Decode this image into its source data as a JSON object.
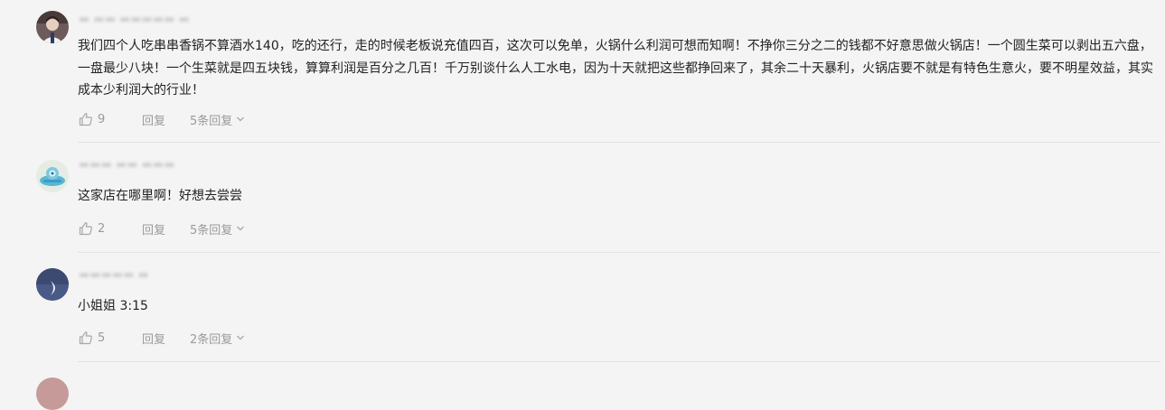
{
  "comments": [
    {
      "username": "▬ ▬▬ ▬▬▬▬▬ ▬",
      "text": "我们四个人吃串串香锅不算酒水140，吃的还行，走的时候老板说充值四百，这次可以免单，火锅什么利润可想而知啊！不挣你三分之二的钱都不好意思做火锅店！一个圆生菜可以剥出五六盘，一盘最少八块！一个生菜就是四五块钱，算算利润是百分之几百！千万别谈什么人工水电，因为十天就把这些都挣回来了，其余二十天暴利，火锅店要不就是有特色生意火，要不明星效益，其实成本少利润大的行业！",
      "likes": "9",
      "reply_label": "回复",
      "replies_label": "5条回复"
    },
    {
      "username": "▬▬▬ ▬▬ ▬▬▬",
      "text": "这家店在哪里啊！好想去尝尝",
      "likes": "2",
      "reply_label": "回复",
      "replies_label": "5条回复"
    },
    {
      "username": "▬▬▬▬▬ ▬",
      "text": "小姐姐 3:15",
      "likes": "5",
      "reply_label": "回复",
      "replies_label": "2条回复"
    }
  ],
  "watermark": "",
  "colors": {
    "background": "#f4f4f4",
    "text": "#222222",
    "meta": "#9a9a9a",
    "divider": "#e2e2e2"
  },
  "icons": {
    "like": "thumbs-up-icon",
    "expand": "chevron-down-icon"
  }
}
